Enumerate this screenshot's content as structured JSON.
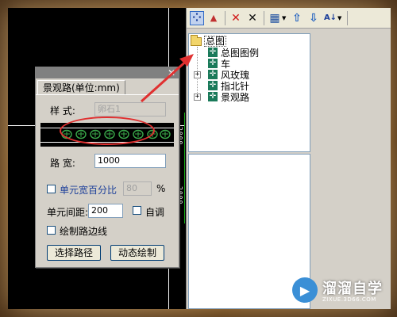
{
  "toolbar": {
    "buttons": [
      {
        "icon": "scatter-points-icon",
        "glyph": "⁘"
      },
      {
        "icon": "triangle-points-icon",
        "glyph": "▲"
      },
      {
        "icon": "delete-red-icon",
        "glyph": "✕"
      },
      {
        "icon": "delete-black-icon",
        "glyph": "✕"
      },
      {
        "icon": "grid-view-icon",
        "glyph": "▦"
      },
      {
        "icon": "move-up-icon",
        "glyph": "⇧"
      },
      {
        "icon": "move-down-icon",
        "glyph": "⇩"
      },
      {
        "icon": "sort-az-icon",
        "glyph": "A↓"
      }
    ]
  },
  "tree": {
    "root": "总图",
    "items": [
      {
        "label": "总图图例",
        "expandable": false
      },
      {
        "label": "车",
        "expandable": false
      },
      {
        "label": "风玫瑰",
        "expandable": true
      },
      {
        "label": "指北针",
        "expandable": false
      },
      {
        "label": "景观路",
        "expandable": true
      }
    ]
  },
  "dialog": {
    "close_glyph": "✕",
    "tab_label": "景观路(单位:mm)",
    "style_label": "样  式:",
    "style_value": "卵石1",
    "width_label": "路  宽:",
    "width_value": "1000",
    "percent_label": "单元宽百分比",
    "percent_value": "80",
    "percent_unit": "%",
    "spacing_label": "单元间距:",
    "spacing_value": "200",
    "auto_label": "自调",
    "edge_label": "绘制路边线",
    "select_path_button": "选择路径",
    "dynamic_draw_button": "动态绘制"
  },
  "canvas": {
    "vertical_text_1": "2000",
    "vertical_text_2": "2000"
  },
  "watermark": {
    "title": "溜溜自学",
    "url": "ZIXUE.3D66.COM"
  },
  "colors": {
    "highlight": "#e03030",
    "cad_background": "#000000",
    "tree_symbol": "#3aa84a",
    "dialog_face": "#d4d0c8"
  }
}
